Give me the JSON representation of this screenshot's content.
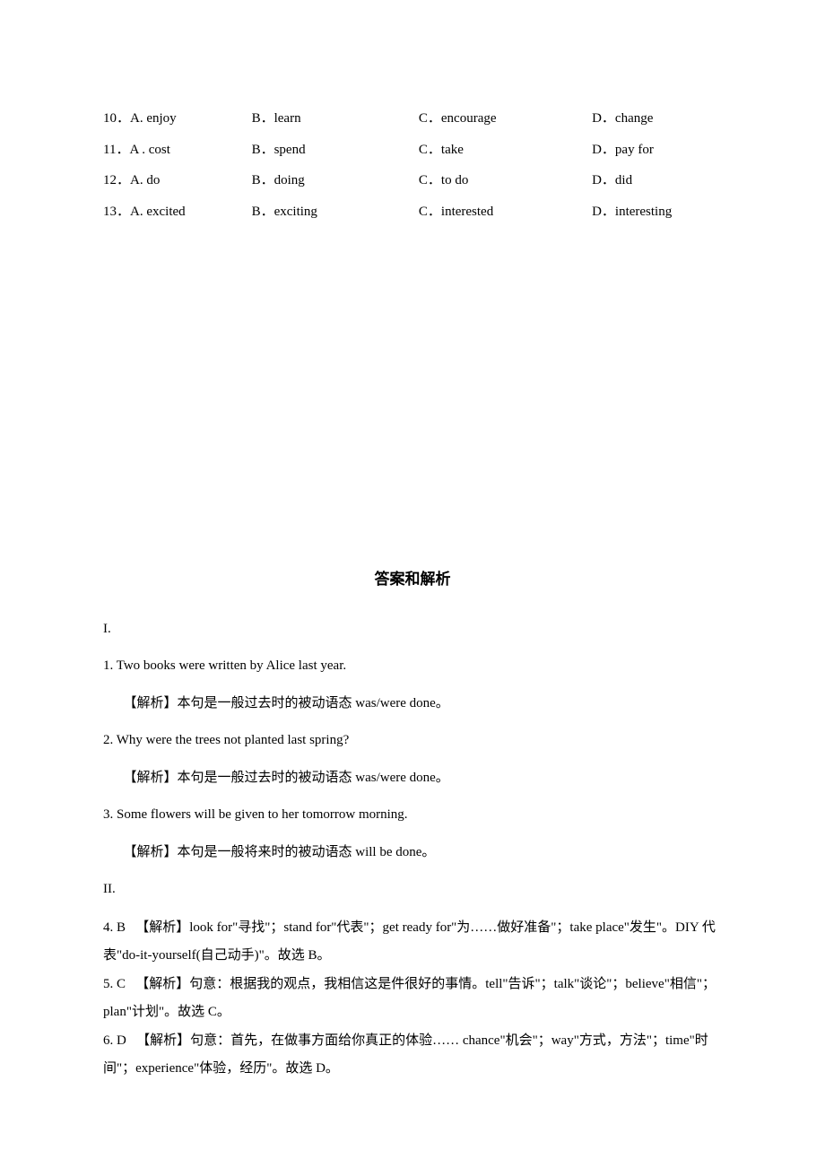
{
  "questions": [
    {
      "num": "10．",
      "a": "A. enjoy",
      "b": "B．learn",
      "c": "C．encourage",
      "d": "D．change"
    },
    {
      "num": "11．",
      "a": "A . cost",
      "b": "B．spend",
      "c": "C．take",
      "d": "D．pay for"
    },
    {
      "num": "12．",
      "a": "A. do",
      "b": "B．doing",
      "c": "C．to do",
      "d": "D．did"
    },
    {
      "num": "13．",
      "a": "A. excited",
      "b": "B．exciting",
      "c": "C．interested",
      "d": "D．interesting"
    }
  ],
  "section_title": "答案和解析",
  "answers": {
    "section1_label": "I.",
    "items1": [
      {
        "line": "1. Two books were written by Alice last year.",
        "exp": "【解析】本句是一般过去时的被动语态 was/were done。"
      },
      {
        "line": "2. Why were the trees not planted last spring?",
        "exp": "【解析】本句是一般过去时的被动语态 was/were done。"
      },
      {
        "line": "3. Some flowers will be given to her tomorrow morning.",
        "exp": "【解析】本句是一般将来时的被动语态 will be done。"
      }
    ],
    "section2_label": "II.",
    "items2": [
      "4. B 　【解析】look for\"寻找\"；stand for\"代表\"；get ready for\"为……做好准备\"；take place\"发生\"。DIY 代表\"do-it-yourself(自己动手)\"。故选 B。",
      "5. C 　【解析】句意：根据我的观点，我相信这是件很好的事情。tell\"告诉\"；talk\"谈论\"；believe\"相信\"；plan\"计划\"。故选 C。",
      "6. D 　【解析】句意：首先，在做事方面给你真正的体验…… chance\"机会\"；way\"方式，方法\"；time\"时间\"；experience\"体验，经历\"。故选 D。"
    ]
  }
}
